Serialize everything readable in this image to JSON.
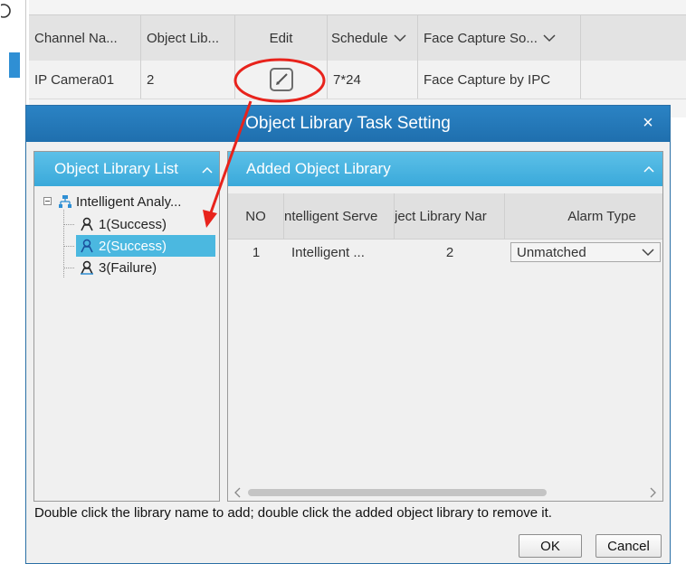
{
  "background_grid": {
    "columns": [
      {
        "label": "Channel Na..."
      },
      {
        "label": "Object Lib..."
      },
      {
        "label": "Edit"
      },
      {
        "label": "Schedule"
      },
      {
        "label": "Face Capture So..."
      }
    ],
    "row": {
      "channel": "IP Camera01",
      "object_library": "2",
      "schedule": "7*24",
      "face_capture": "Face Capture by IPC"
    }
  },
  "dialog": {
    "title": "Object Library Task Setting",
    "close_label": "×",
    "left_panel": {
      "title": "Object Library List",
      "tree": {
        "root_label": "Intelligent Analy...",
        "items": [
          {
            "label": "1(Success)",
            "selected": false
          },
          {
            "label": "2(Success)",
            "selected": true
          },
          {
            "label": "3(Failure)",
            "selected": false
          }
        ]
      }
    },
    "right_panel": {
      "title": "Added Object Library",
      "headers": {
        "no": "NO",
        "server": "ntelligent Serve",
        "library": "ject Library Nar",
        "alarm": "Alarm Type"
      },
      "rows": [
        {
          "no": "1",
          "server": "Intelligent ...",
          "library": "2",
          "alarm_type": "Unmatched"
        }
      ]
    },
    "hint": "Double click the library name to add; double click the added object library to remove it.",
    "ok_label": "OK",
    "cancel_label": "Cancel"
  },
  "colors": {
    "title_bar": "#2378b9",
    "panel_header": "#4cb6e2",
    "selection": "#4bb8e0",
    "annotation": "#e8231c"
  }
}
